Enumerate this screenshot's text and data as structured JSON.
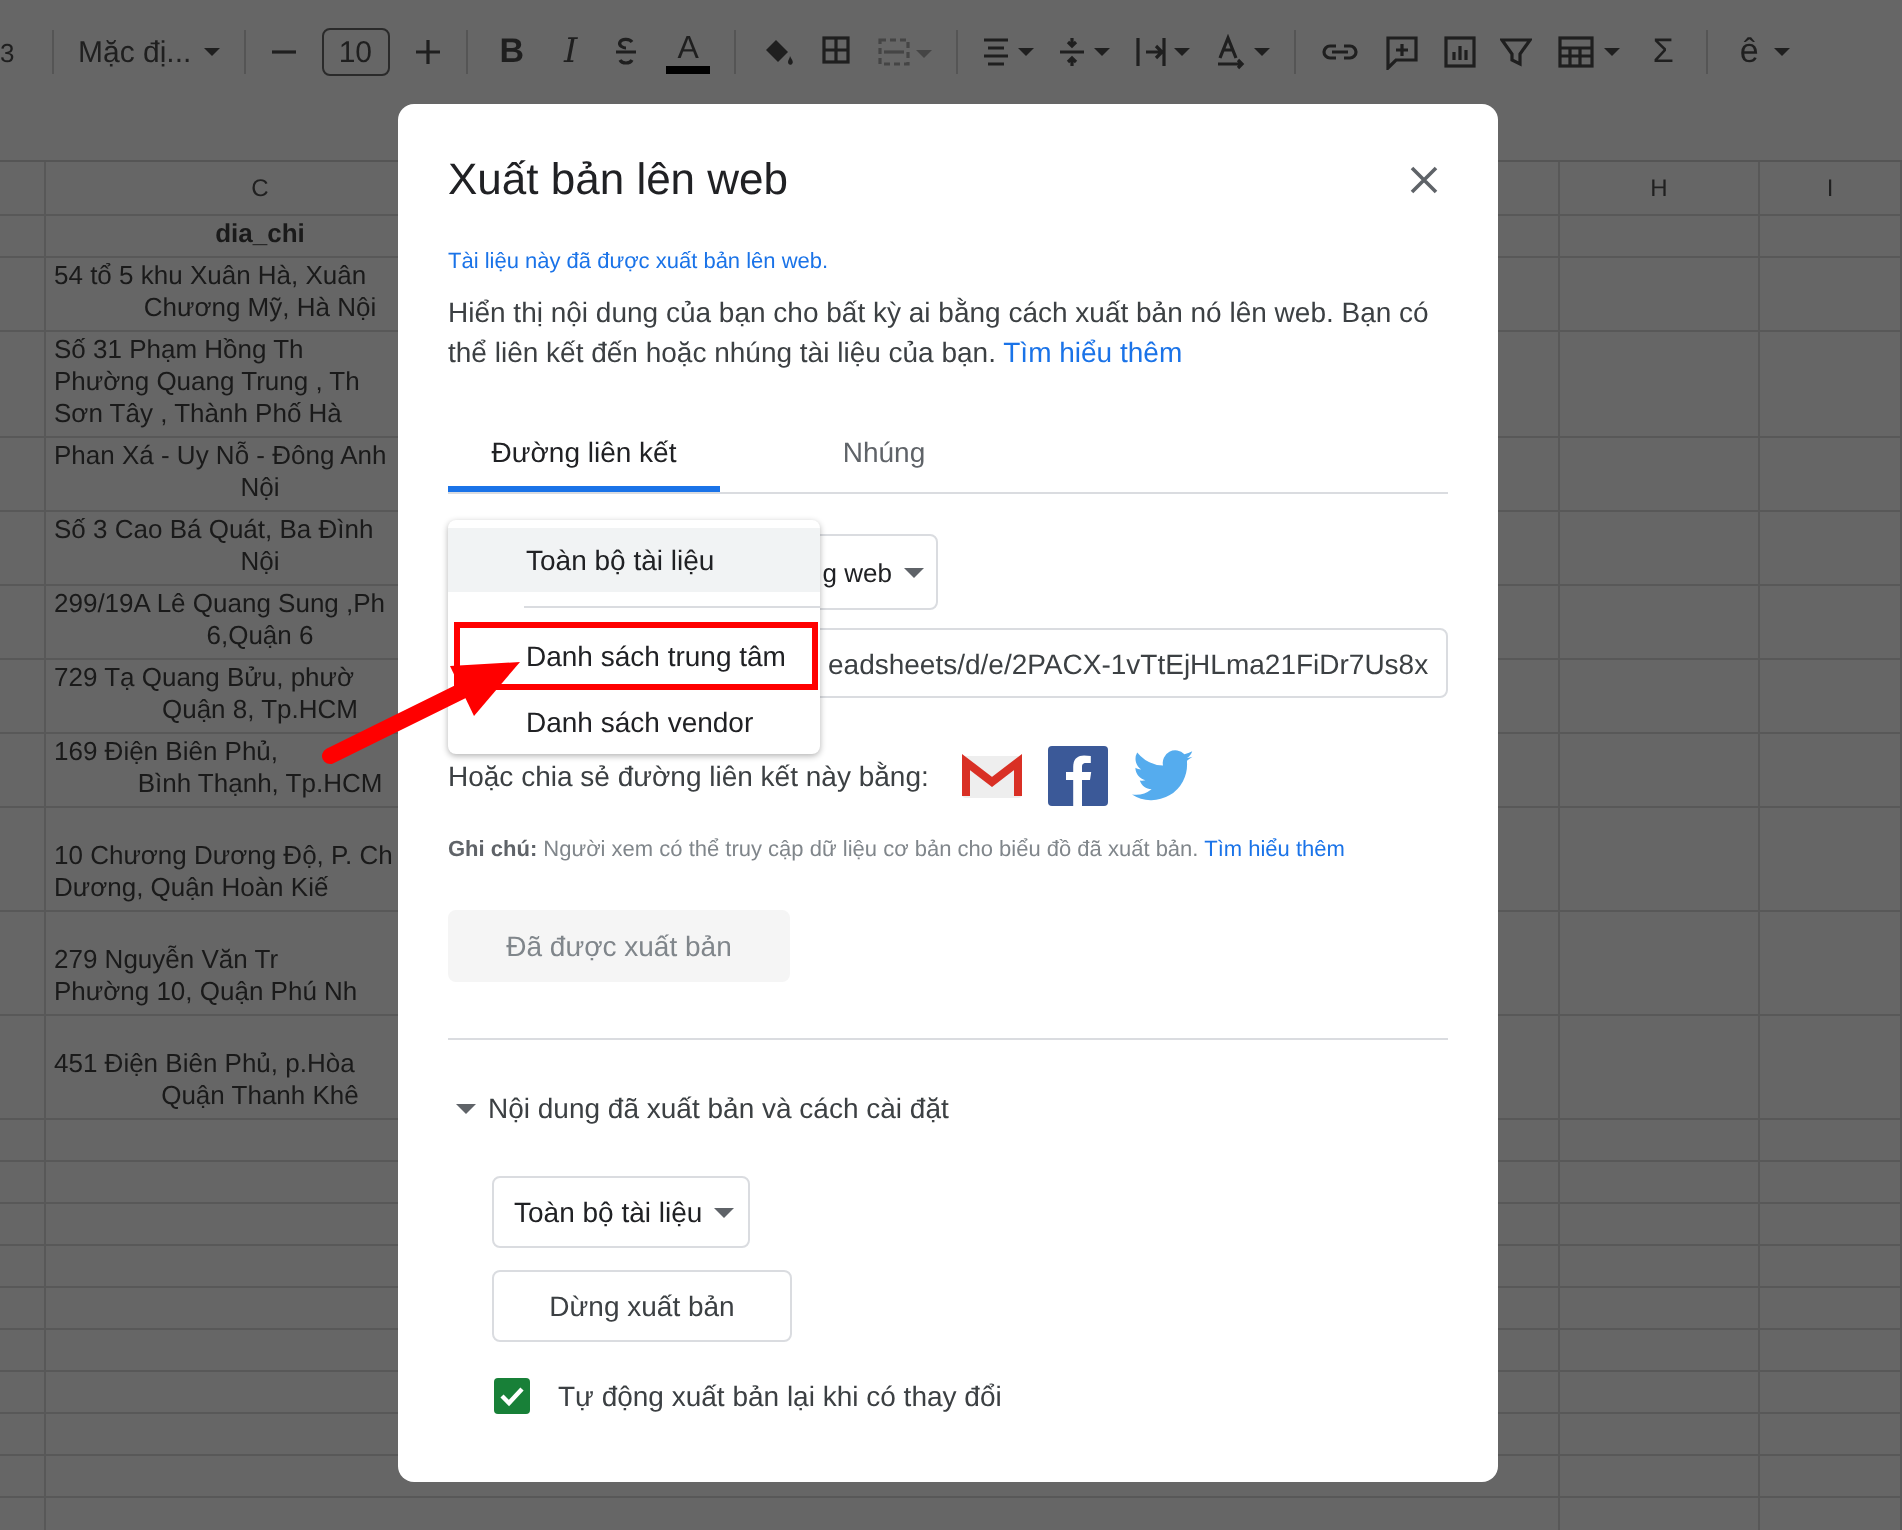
{
  "toolbar": {
    "cut_label": "3",
    "font": "Mặc đị...",
    "font_size": "10",
    "bold": "B",
    "italic": "I",
    "text_color": "A",
    "sum": "Σ",
    "input_tools": "ê",
    "merge_disabled": true
  },
  "sheet": {
    "columns": [
      {
        "label": "C"
      },
      {
        "label": "H"
      },
      {
        "label": "I"
      }
    ],
    "rows": [
      {
        "kind": "header",
        "lines": [
          {
            "text": "dia_chi",
            "cut": false
          }
        ]
      },
      {
        "kind": "data",
        "lines": [
          {
            "text": "54 tổ 5 khu Xuân Hà, Xuân",
            "cut": true
          },
          {
            "text": "Chương Mỹ, Hà Nội",
            "cut": false
          }
        ]
      },
      {
        "kind": "data",
        "lines": [
          {
            "text": "Số 31 Phạm Hồng Th",
            "cut": true
          },
          {
            "text": "Phường Quang Trung , Th",
            "cut": true
          },
          {
            "text": "Sơn Tây , Thành Phố Hà",
            "cut": true
          }
        ]
      },
      {
        "kind": "data",
        "lines": [
          {
            "text": "Phan Xá - Uy Nỗ - Đông Anh",
            "cut": true
          },
          {
            "text": "Nội",
            "cut": false
          }
        ]
      },
      {
        "kind": "data",
        "lines": [
          {
            "text": "Số 3 Cao Bá Quát, Ba Đình",
            "cut": true
          },
          {
            "text": "Nội",
            "cut": false
          }
        ]
      },
      {
        "kind": "data",
        "lines": [
          {
            "text": "299/19A Lê Quang Sung ,Ph",
            "cut": true
          },
          {
            "text": "6,Quận 6",
            "cut": false
          }
        ]
      },
      {
        "kind": "data",
        "lines": [
          {
            "text": "729 Tạ Quang Bửu, phườ",
            "cut": true
          },
          {
            "text": "Quận 8, Tp.HCM",
            "cut": false
          }
        ]
      },
      {
        "kind": "data",
        "lines": [
          {
            "text": "169 Điện Biên Phủ,",
            "cut": true
          },
          {
            "text": "Bình Thạnh, Tp.HCM",
            "cut": false
          }
        ]
      },
      {
        "kind": "data",
        "lines": [
          {
            "text": "10 Chương Dương Độ, P. Ch",
            "cut": true
          },
          {
            "text": "Dương, Quận Hoàn Kiế",
            "cut": true
          }
        ]
      },
      {
        "kind": "data",
        "lines": [
          {
            "text": "279 Nguyễn Văn Tr",
            "cut": true
          },
          {
            "text": "Phường 10, Quận Phú Nh",
            "cut": true
          }
        ]
      },
      {
        "kind": "data",
        "lines": [
          {
            "text": "451 Điện Biên Phủ, p.Hòa",
            "cut": true
          },
          {
            "text": "Quận Thanh Khê",
            "cut": false
          }
        ]
      }
    ]
  },
  "dialog": {
    "title": "Xuất bản lên web",
    "status": "Tài liệu này đã được xuất bản lên web.",
    "description": "Hiển thị nội dung của bạn cho bất kỳ ai bằng cách xuất bản nó lên web. Bạn có thể liên kết đến hoặc nhúng tài liệu của bạn.",
    "description_link": "Tìm hiểu thêm",
    "tabs": [
      {
        "label": "Đường liên kết",
        "selected": true
      },
      {
        "label": "Nhúng",
        "selected": false
      }
    ],
    "format_select": "g web",
    "link_field": {
      "value": "eadsheets/d/e/2PACX-1vTtEjHLma21FiDr7Us8x"
    },
    "share_label": "Hoặc chia sẻ đường liên kết này bằng:",
    "note": "**Ghi chú:** Người xem có thể truy cập dữ liệu cơ bản cho biểu đồ đã xuất bản.",
    "note_link": "Tìm hiểu thêm",
    "publish_button": {
      "label": "Đã được xuất bản",
      "disabled": true
    },
    "section": {
      "label": "Nội dung đã xuất bản và cách cài đặt",
      "expanded": true
    },
    "scope_select": "Toàn bộ tài liệu",
    "stop_button": "Dừng xuất bản",
    "auto_republish": {
      "label": "Tự động xuất bản lại khi có thay đổi",
      "checked": true
    }
  },
  "menu": {
    "items": [
      {
        "label": "Toàn bộ tài liệu",
        "selected": true,
        "boxed": false,
        "separator_after": true
      },
      {
        "label": "Danh sách trung tâm",
        "selected": false,
        "boxed": true,
        "separator_after": false
      },
      {
        "label": "Danh sách vendor",
        "selected": false,
        "boxed": false,
        "separator_after": false
      }
    ]
  },
  "annotation": {
    "arrow": true
  }
}
